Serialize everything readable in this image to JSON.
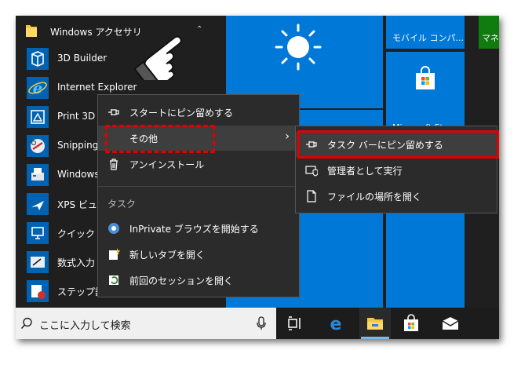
{
  "start_menu": {
    "group": {
      "label": "Windows アクセサリ",
      "icon": "folder-icon"
    },
    "apps": [
      {
        "label": "3D Builder",
        "icon": "3d-builder-icon"
      },
      {
        "label": "Internet Explorer",
        "icon": "internet-explorer-icon"
      },
      {
        "label": "Print 3D",
        "icon": "print-3d-icon"
      },
      {
        "label": "Snipping",
        "icon": "snipping-tool-icon"
      },
      {
        "label": "Windows",
        "icon": "windows-fax-icon"
      },
      {
        "label": "XPS ビュー",
        "icon": "xps-viewer-icon"
      },
      {
        "label": "クイック ア",
        "icon": "quick-assist-icon"
      },
      {
        "label": "数式入力",
        "icon": "math-input-icon"
      },
      {
        "label": "ステップ記",
        "icon": "steps-recorder-icon"
      }
    ]
  },
  "tiles": {
    "mobile": "モバイル コンパ...",
    "money": "マネ",
    "store": "Microsoft Store"
  },
  "context_menu": {
    "pin_start": "スタートにピン留めする",
    "more": "その他",
    "uninstall": "アンインストール",
    "tasks_header": "タスク",
    "inprivate": "InPrivate ブラウズを開始する",
    "new_tab": "新しいタブを開く",
    "reopen_session": "前回のセッションを開く"
  },
  "submenu": {
    "pin_taskbar": "タスク バーにピン留めする",
    "run_as_admin": "管理者として実行",
    "open_location": "ファイルの場所を開く"
  },
  "taskbar": {
    "search_placeholder": "ここに入力して検索"
  },
  "colors": {
    "accent": "#0078d7",
    "highlight": "#e00000",
    "money_tile": "#107c10"
  }
}
